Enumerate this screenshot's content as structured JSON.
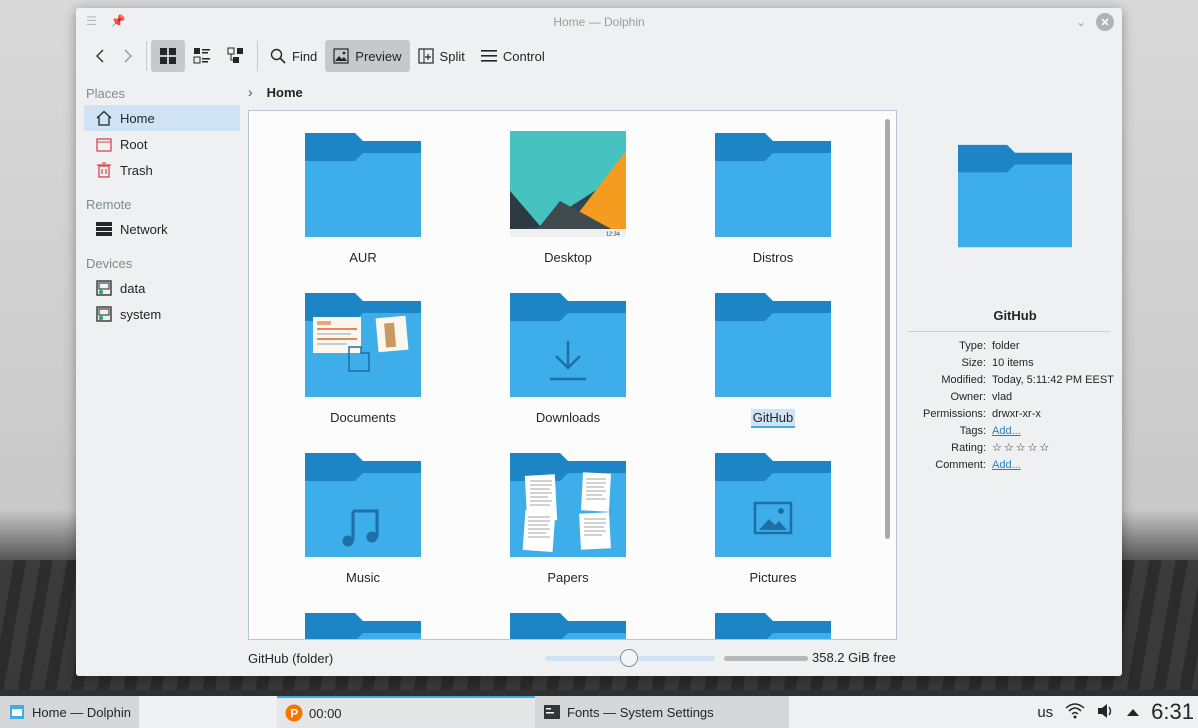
{
  "window": {
    "title": "Home — Dolphin"
  },
  "toolbar": {
    "back_icon": "chevron-left-icon",
    "forward_icon": "chevron-right-icon",
    "find_label": "Find",
    "preview_label": "Preview",
    "split_label": "Split",
    "control_label": "Control"
  },
  "sidebar": {
    "sections": [
      {
        "title": "Places",
        "items": [
          {
            "label": "Home",
            "icon": "home-icon"
          },
          {
            "label": "Root",
            "icon": "root-folder-icon"
          },
          {
            "label": "Trash",
            "icon": "trash-icon"
          }
        ]
      },
      {
        "title": "Remote",
        "items": [
          {
            "label": "Network",
            "icon": "network-icon"
          }
        ]
      },
      {
        "title": "Devices",
        "items": [
          {
            "label": "data",
            "icon": "drive-icon"
          },
          {
            "label": "system",
            "icon": "drive-icon"
          }
        ]
      }
    ]
  },
  "location": {
    "crumb": "Home"
  },
  "files": [
    {
      "name": "AUR"
    },
    {
      "name": "Desktop",
      "thumb_time": "12:34"
    },
    {
      "name": "Distros"
    },
    {
      "name": "Documents"
    },
    {
      "name": "Downloads"
    },
    {
      "name": "GitHub"
    },
    {
      "name": "Music"
    },
    {
      "name": "Papers"
    },
    {
      "name": "Pictures"
    }
  ],
  "info": {
    "name": "GitHub",
    "rows": [
      {
        "key": "Type:",
        "value": "folder"
      },
      {
        "key": "Size:",
        "value": "10 items"
      },
      {
        "key": "Modified:",
        "value": "Today, 5:11:42 PM EEST"
      },
      {
        "key": "Owner:",
        "value": "vlad"
      },
      {
        "key": "Permissions:",
        "value": "drwxr-xr-x"
      },
      {
        "key": "Tags:",
        "value": "Add..."
      },
      {
        "key": "Rating:",
        "value": "☆☆☆☆☆"
      },
      {
        "key": "Comment:",
        "value": "Add..."
      }
    ],
    "rating": 0
  },
  "status": {
    "selection": "GitHub (folder)",
    "free_space": "358.2 GiB free"
  },
  "taskbar": {
    "tasks": [
      {
        "label": "Home — Dolphin"
      },
      {
        "label": "00:00"
      },
      {
        "label": "Fonts — System Settings"
      }
    ],
    "keyboard_layout": "us",
    "clock": "6:31"
  }
}
